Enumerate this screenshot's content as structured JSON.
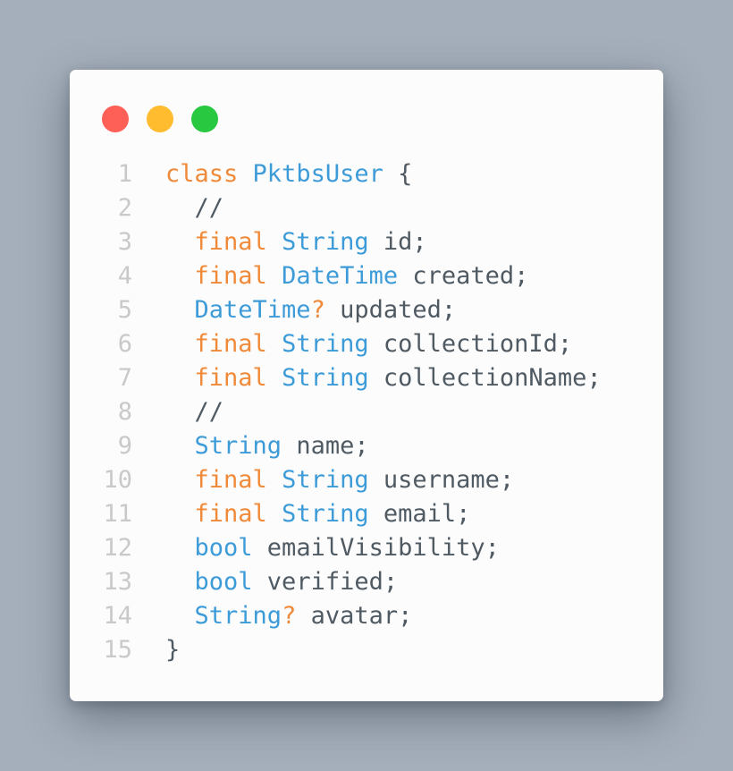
{
  "window": {
    "controls": [
      {
        "name": "close",
        "color": "#fe5f57"
      },
      {
        "name": "minimize",
        "color": "#febc2e"
      },
      {
        "name": "maximize",
        "color": "#28c840"
      }
    ]
  },
  "code": {
    "language": "dart",
    "colors": {
      "keyword": "#ef8a3a",
      "type": "#3d9bd8",
      "text": "#505a63",
      "line_number": "#c9c9c9"
    },
    "lines": [
      {
        "n": "1",
        "tokens": [
          {
            "t": "kw",
            "v": "class"
          },
          {
            "t": "tx",
            "v": " "
          },
          {
            "t": "ty",
            "v": "PktbsUser"
          },
          {
            "t": "tx",
            "v": " {"
          }
        ]
      },
      {
        "n": "2",
        "tokens": [
          {
            "t": "tx",
            "v": "  //"
          }
        ]
      },
      {
        "n": "3",
        "tokens": [
          {
            "t": "tx",
            "v": "  "
          },
          {
            "t": "kw",
            "v": "final"
          },
          {
            "t": "tx",
            "v": " "
          },
          {
            "t": "ty",
            "v": "String"
          },
          {
            "t": "tx",
            "v": " id;"
          }
        ]
      },
      {
        "n": "4",
        "tokens": [
          {
            "t": "tx",
            "v": "  "
          },
          {
            "t": "kw",
            "v": "final"
          },
          {
            "t": "tx",
            "v": " "
          },
          {
            "t": "ty",
            "v": "DateTime"
          },
          {
            "t": "tx",
            "v": " created;"
          }
        ]
      },
      {
        "n": "5",
        "tokens": [
          {
            "t": "tx",
            "v": "  "
          },
          {
            "t": "ty",
            "v": "DateTime"
          },
          {
            "t": "kw",
            "v": "?"
          },
          {
            "t": "tx",
            "v": " updated;"
          }
        ]
      },
      {
        "n": "6",
        "tokens": [
          {
            "t": "tx",
            "v": "  "
          },
          {
            "t": "kw",
            "v": "final"
          },
          {
            "t": "tx",
            "v": " "
          },
          {
            "t": "ty",
            "v": "String"
          },
          {
            "t": "tx",
            "v": " collectionId;"
          }
        ]
      },
      {
        "n": "7",
        "tokens": [
          {
            "t": "tx",
            "v": "  "
          },
          {
            "t": "kw",
            "v": "final"
          },
          {
            "t": "tx",
            "v": " "
          },
          {
            "t": "ty",
            "v": "String"
          },
          {
            "t": "tx",
            "v": " collectionName;"
          }
        ]
      },
      {
        "n": "8",
        "tokens": [
          {
            "t": "tx",
            "v": "  //"
          }
        ]
      },
      {
        "n": "9",
        "tokens": [
          {
            "t": "tx",
            "v": "  "
          },
          {
            "t": "ty",
            "v": "String"
          },
          {
            "t": "tx",
            "v": " name;"
          }
        ]
      },
      {
        "n": "10",
        "tokens": [
          {
            "t": "tx",
            "v": "  "
          },
          {
            "t": "kw",
            "v": "final"
          },
          {
            "t": "tx",
            "v": " "
          },
          {
            "t": "ty",
            "v": "String"
          },
          {
            "t": "tx",
            "v": " username;"
          }
        ]
      },
      {
        "n": "11",
        "tokens": [
          {
            "t": "tx",
            "v": "  "
          },
          {
            "t": "kw",
            "v": "final"
          },
          {
            "t": "tx",
            "v": " "
          },
          {
            "t": "ty",
            "v": "String"
          },
          {
            "t": "tx",
            "v": " email;"
          }
        ]
      },
      {
        "n": "12",
        "tokens": [
          {
            "t": "tx",
            "v": "  "
          },
          {
            "t": "ty",
            "v": "bool"
          },
          {
            "t": "tx",
            "v": " emailVisibility;"
          }
        ]
      },
      {
        "n": "13",
        "tokens": [
          {
            "t": "tx",
            "v": "  "
          },
          {
            "t": "ty",
            "v": "bool"
          },
          {
            "t": "tx",
            "v": " verified;"
          }
        ]
      },
      {
        "n": "14",
        "tokens": [
          {
            "t": "tx",
            "v": "  "
          },
          {
            "t": "ty",
            "v": "String"
          },
          {
            "t": "kw",
            "v": "?"
          },
          {
            "t": "tx",
            "v": " avatar;"
          }
        ]
      },
      {
        "n": "15",
        "tokens": [
          {
            "t": "tx",
            "v": "}"
          }
        ]
      }
    ]
  }
}
